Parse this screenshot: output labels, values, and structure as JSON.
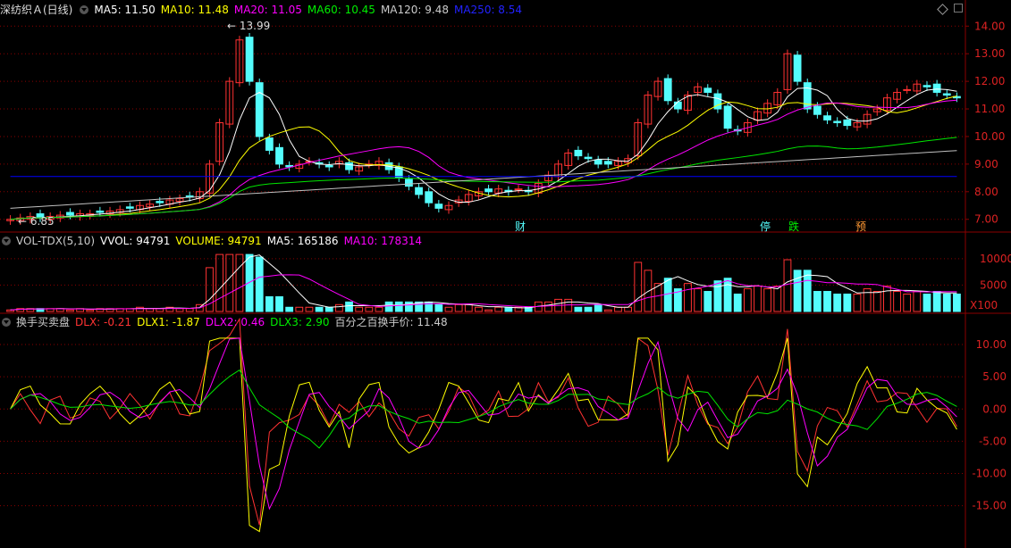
{
  "price_header": {
    "title": "深纺织Ａ(日线)",
    "ma5": "MA5: 11.50",
    "ma10": "MA10: 11.48",
    "ma20": "MA20: 11.05",
    "ma60": "MA60: 10.45",
    "ma120": "MA120: 9.48",
    "ma250": "MA250: 8.54"
  },
  "vol_header": {
    "title": "VOL-TDX(5,10)",
    "vvol": "VVOL: 94791",
    "volume": "VOLUME: 94791",
    "ma5": "MA5: 165186",
    "ma10": "MA10: 178314"
  },
  "ind_header": {
    "title": "换手买卖盘",
    "dlx": "DLX: -0.21",
    "dlx1": "DLX1: -1.87",
    "dlx2": "DLX2: 0.46",
    "dlx3": "DLX3: 2.90",
    "pct": "百分之百换手价: 11.48"
  },
  "colors": {
    "up": "#ff3232",
    "down": "#54fcfc",
    "ma5": "#ffffff",
    "ma10": "#ffff00",
    "ma20": "#ff00ff",
    "ma60": "#00e600",
    "ma120": "#c0c0c0",
    "ma250": "#0000ff",
    "grid": "#8b0000"
  },
  "chart_data": [
    {
      "type": "candlestick",
      "title": "深纺织Ａ(日线)",
      "yticks": [
        "14.00",
        "13.00",
        "12.00",
        "11.00",
        "10.00",
        "9.00",
        "8.00",
        "7.00"
      ],
      "ylim": [
        6.7,
        14.3
      ],
      "annotations": {
        "high": "13.99",
        "low": "6.85"
      },
      "event_marks": [
        "财",
        "停",
        "跌",
        "预"
      ],
      "close_approx": [
        7.0,
        7.05,
        7.1,
        7.05,
        7.1,
        7.15,
        7.15,
        7.2,
        7.2,
        7.25,
        7.3,
        7.35,
        7.4,
        7.5,
        7.55,
        7.6,
        7.7,
        7.75,
        7.8,
        8.0,
        9.0,
        10.5,
        12.0,
        13.5,
        12.0,
        10.0,
        9.5,
        9.0,
        8.9,
        9.0,
        9.1,
        9.0,
        8.9,
        9.1,
        8.8,
        8.9,
        9.0,
        9.1,
        8.8,
        8.5,
        8.2,
        7.9,
        7.6,
        7.4,
        7.5,
        7.7,
        7.9,
        8.0,
        8.0,
        8.1,
        8.0,
        8.1,
        8.0,
        8.3,
        8.6,
        9.0,
        9.4,
        9.3,
        9.2,
        9.0,
        9.0,
        9.1,
        9.2,
        10.5,
        11.5,
        12.0,
        11.3,
        11.0,
        11.5,
        11.8,
        11.6,
        11.0,
        10.3,
        10.2,
        10.5,
        10.9,
        11.2,
        11.6,
        13.0,
        12.0,
        11.0,
        10.8,
        10.6,
        10.5,
        10.4,
        10.5,
        10.8,
        11.0,
        11.4,
        11.6,
        11.7,
        11.9,
        11.8,
        11.6,
        11.5,
        11.4
      ]
    },
    {
      "type": "bar",
      "title": "VOL-TDX(5,10)",
      "yticks": [
        "10000",
        "5000"
      ],
      "unit": "X100",
      "ylim": [
        0,
        12000
      ]
    },
    {
      "type": "line",
      "title": "换手买卖盘",
      "yticks": [
        "10.00",
        "5.00",
        "0.00",
        "-5.00",
        "-10.00",
        "-15.00"
      ],
      "ylim": [
        -21,
        12.5
      ],
      "series": [
        {
          "name": "DLX",
          "color": "#ff3232"
        },
        {
          "name": "DLX1",
          "color": "#ffff00"
        },
        {
          "name": "DLX2",
          "color": "#ff00ff"
        },
        {
          "name": "DLX3",
          "color": "#00e600"
        }
      ]
    }
  ]
}
